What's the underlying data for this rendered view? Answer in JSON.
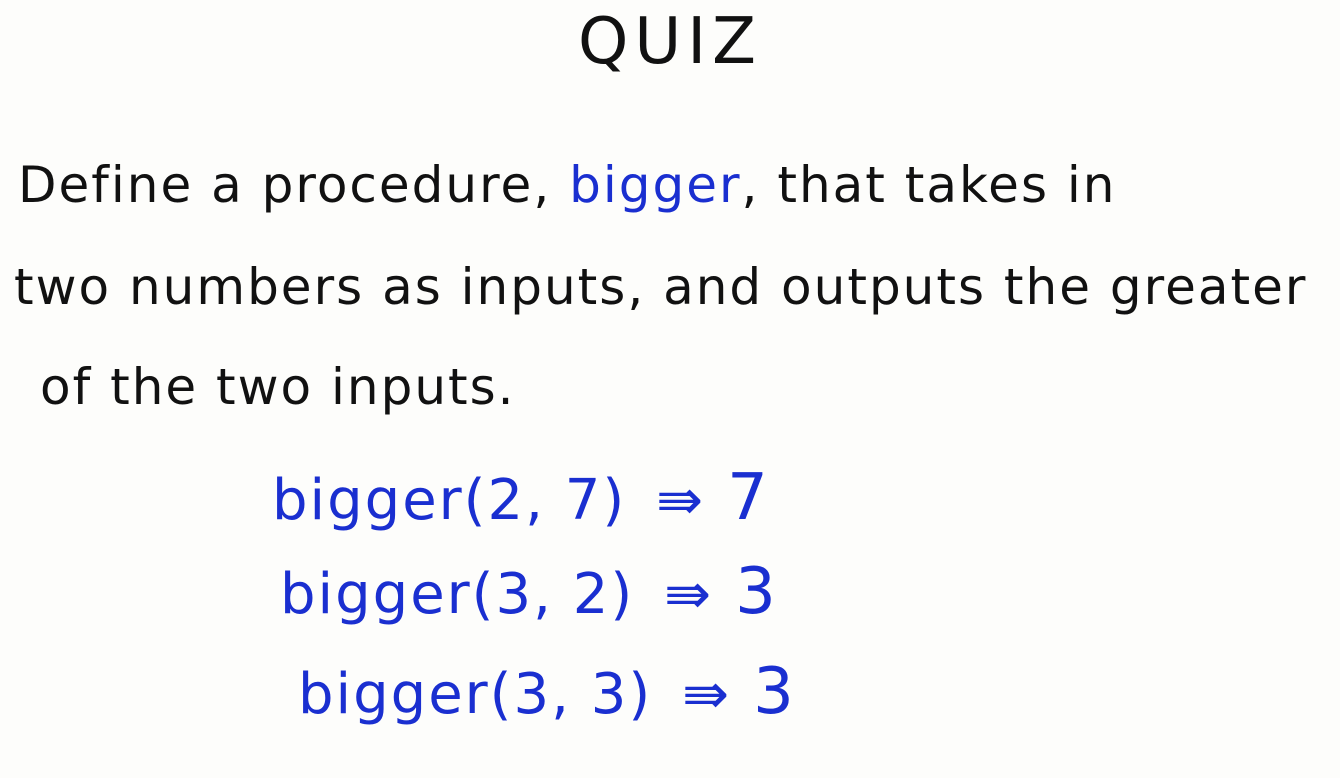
{
  "title": "QUIZ",
  "question": {
    "line1_before": "Define a procedure, ",
    "procedure_name": "bigger",
    "line1_after": ", that takes in",
    "line2": "two numbers as inputs, and outputs the greater",
    "line3": "of the two inputs."
  },
  "examples": [
    {
      "call": "bigger(2, 7)",
      "arrow": "⇛",
      "result": "7"
    },
    {
      "call": "bigger(3, 2)",
      "arrow": "⇛",
      "result": "3"
    },
    {
      "call": "bigger(3, 3)",
      "arrow": "⇛",
      "result": "3"
    }
  ],
  "colors": {
    "ink": "#111111",
    "accent": "#1a2fd0",
    "background": "#fdfdfb"
  }
}
